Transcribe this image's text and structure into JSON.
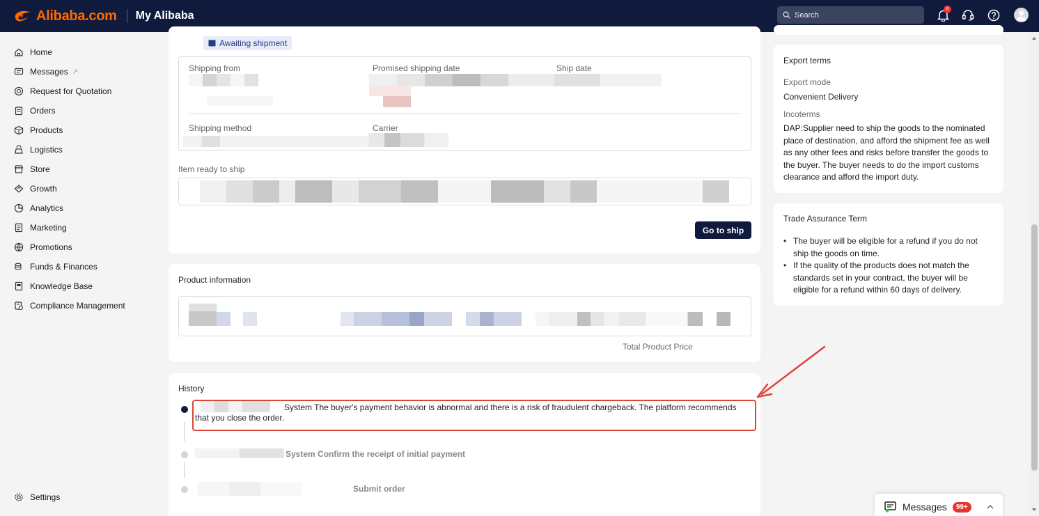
{
  "header": {
    "brand": "Alibaba.com",
    "section": "My Alibaba",
    "search_placeholder": "Search",
    "notification_count": "6"
  },
  "sidebar": {
    "items": [
      {
        "label": "Home",
        "icon": "home-icon"
      },
      {
        "label": "Messages",
        "icon": "message-icon",
        "ext": "↗"
      },
      {
        "label": "Request for Quotation",
        "icon": "rfq-icon"
      },
      {
        "label": "Orders",
        "icon": "orders-icon"
      },
      {
        "label": "Products",
        "icon": "products-icon"
      },
      {
        "label": "Logistics",
        "icon": "logistics-icon"
      },
      {
        "label": "Store",
        "icon": "store-icon"
      },
      {
        "label": "Growth",
        "icon": "growth-icon"
      },
      {
        "label": "Analytics",
        "icon": "analytics-icon"
      },
      {
        "label": "Marketing",
        "icon": "marketing-icon"
      },
      {
        "label": "Promotions",
        "icon": "promotions-icon"
      },
      {
        "label": "Funds & Finances",
        "icon": "funds-icon"
      },
      {
        "label": "Knowledge Base",
        "icon": "knowledge-icon"
      },
      {
        "label": "Compliance Management",
        "icon": "compliance-icon"
      }
    ],
    "settings": "Settings"
  },
  "shipment": {
    "status": "Awaiting shipment",
    "shipping_from": "Shipping from",
    "promised_date": "Promised shipping date",
    "ship_date": "Ship date",
    "shipping_method": "Shipping method",
    "carrier": "Carrier",
    "item_ready": "Item ready to ship",
    "go_to_ship": "Go to ship"
  },
  "product": {
    "title": "Product information",
    "total_price_label": "Total Product Price"
  },
  "history": {
    "title": "History",
    "entries": [
      {
        "text": "System The buyer's payment behavior is abnormal and there is a risk of fraudulent chargeback. The platform recommends that you close the order."
      },
      {
        "text": "System Confirm the receipt of initial payment"
      },
      {
        "text": "Submit order"
      }
    ]
  },
  "export_terms": {
    "title": "Export terms",
    "mode_label": "Export mode",
    "mode_value": "Convenient Delivery",
    "incoterms_label": "Incoterms",
    "incoterms_value": "DAP:Supplier need to ship the goods to the nominated place of destination, and afford the shipment fee as well as any other fees and risks before transfer the goods to the buyer. The buyer needs to do the import customs clearance and afford the import duty."
  },
  "trade_assurance": {
    "title": "Trade Assurance Term",
    "bullets": [
      "The buyer will be eligible for a refund if you do not ship the goods on time.",
      "If the quality of the products does not match the standards set in your contract, the buyer will be eligible for a refund within 60 days of delivery."
    ]
  },
  "messages_widget": {
    "label": "Messages",
    "count": "99+"
  },
  "colors": {
    "topbar": "#0f1a3c",
    "brand_orange": "#ff6a00",
    "highlight_red": "#e0433a"
  }
}
